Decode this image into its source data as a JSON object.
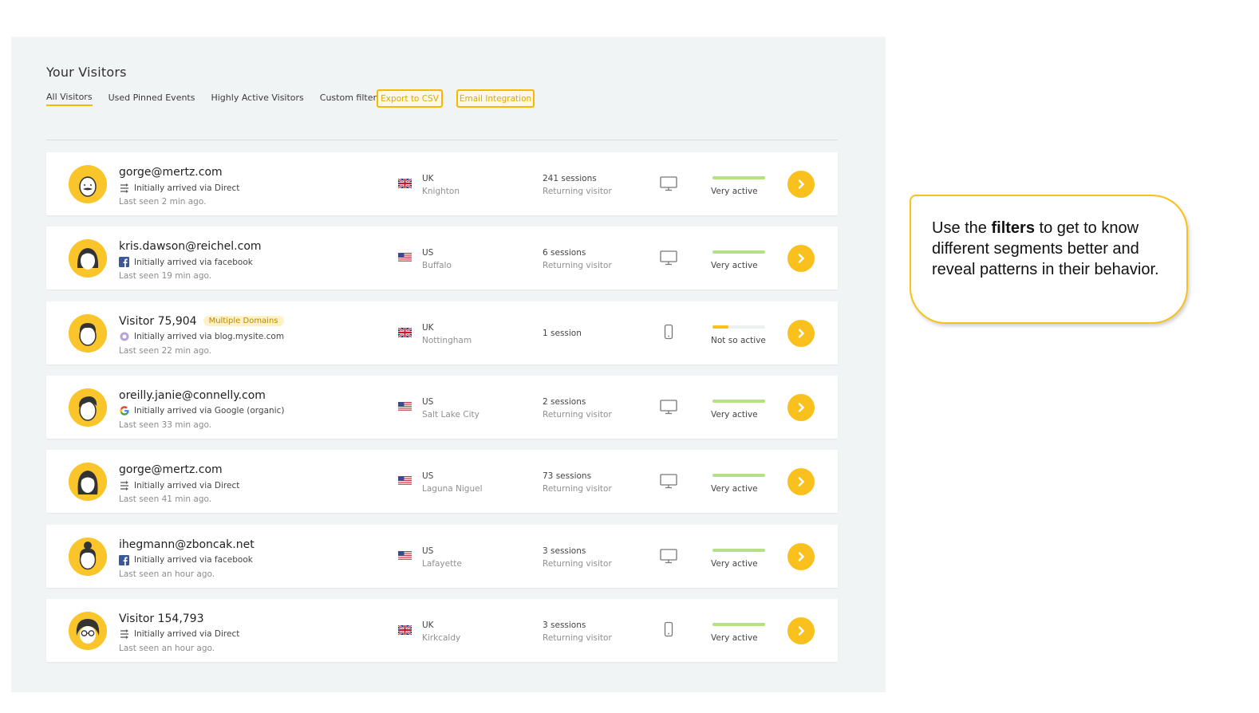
{
  "panel": {
    "title": "Your Visitors",
    "tabs": [
      {
        "label": "All Visitors",
        "active": true
      },
      {
        "label": "Used Pinned Events",
        "active": false
      },
      {
        "label": "Highly Active Visitors",
        "active": false
      },
      {
        "label": "Custom filters",
        "active": false,
        "dropdown": true
      }
    ],
    "export_label": "Export to CSV",
    "email_label": "Email Integration"
  },
  "colors": {
    "accent": "#f6b800",
    "active_bar": "#b5e089",
    "low_bar": "#f9c01e"
  },
  "visitors": [
    {
      "name": "gorge@mertz.com",
      "badge": "",
      "source_icon": "direct-icon",
      "source": "Initially arrived via Direct",
      "last_seen": "Last seen 2 min ago.",
      "flag": "uk-flag-icon",
      "country": "UK",
      "city": "Knighton",
      "sessions": "241 sessions",
      "returning": "Returning visitor",
      "device": "desktop-icon",
      "activity_level": 1.0,
      "activity": "Very active",
      "avatar": "mustache"
    },
    {
      "name": "kris.dawson@reichel.com",
      "badge": "",
      "source_icon": "facebook-icon",
      "source": "Initially arrived via facebook",
      "last_seen": "Last seen 19 min ago.",
      "flag": "us-flag-icon",
      "country": "US",
      "city": "Buffalo",
      "sessions": "6 sessions",
      "returning": "Returning visitor",
      "device": "desktop-icon",
      "activity_level": 1.0,
      "activity": "Very active",
      "avatar": "bob-hair"
    },
    {
      "name": "Visitor 75,904",
      "badge": "Multiple Domains",
      "source_icon": "referrer-icon",
      "source": "Initially arrived via blog.mysite.com",
      "last_seen": "Last seen 22 min ago.",
      "flag": "uk-flag-icon",
      "country": "UK",
      "city": "Nottingham",
      "sessions": "1 session",
      "returning": "",
      "device": "mobile-icon",
      "activity_level": 0.3,
      "activity": "Not so active",
      "avatar": "short-hair"
    },
    {
      "name": "oreilly.janie@connelly.com",
      "badge": "",
      "source_icon": "google-icon",
      "source": "Initially arrived via Google (organic)",
      "last_seen": "Last seen 33 min ago.",
      "flag": "us-flag-icon",
      "country": "US",
      "city": "Salt Lake City",
      "sessions": "2 sessions",
      "returning": "Returning visitor",
      "device": "desktop-icon",
      "activity_level": 1.0,
      "activity": "Very active",
      "avatar": "swoop-hair"
    },
    {
      "name": "gorge@mertz.com",
      "badge": "",
      "source_icon": "direct-icon",
      "source": "Initially arrived via Direct",
      "last_seen": "Last seen 41 min ago.",
      "flag": "us-flag-icon",
      "country": "US",
      "city": "Laguna Niguel",
      "sessions": "73 sessions",
      "returning": "Returning visitor",
      "device": "desktop-icon",
      "activity_level": 1.0,
      "activity": "Very active",
      "avatar": "long-hair"
    },
    {
      "name": "ihegmann@zboncak.net",
      "badge": "",
      "source_icon": "facebook-icon",
      "source": "Initially arrived via facebook",
      "last_seen": "Last seen an hour ago.",
      "flag": "us-flag-icon",
      "country": "US",
      "city": "Lafayette",
      "sessions": "3 sessions",
      "returning": "Returning visitor",
      "device": "desktop-icon",
      "activity_level": 1.0,
      "activity": "Very active",
      "avatar": "bun-hair"
    },
    {
      "name": "Visitor 154,793",
      "badge": "",
      "source_icon": "direct-icon",
      "source": "Initially arrived via Direct",
      "last_seen": "Last seen an hour ago.",
      "flag": "uk-flag-icon",
      "country": "UK",
      "city": "Kirkcaldy",
      "sessions": "3 sessions",
      "returning": "Returning visitor",
      "device": "mobile-icon",
      "activity_level": 1.0,
      "activity": "Very active",
      "avatar": "glasses"
    }
  ],
  "callout": {
    "before": "Use the ",
    "bold": "filters",
    "after": " to get to know different segments better and reveal patterns in their behavior."
  }
}
